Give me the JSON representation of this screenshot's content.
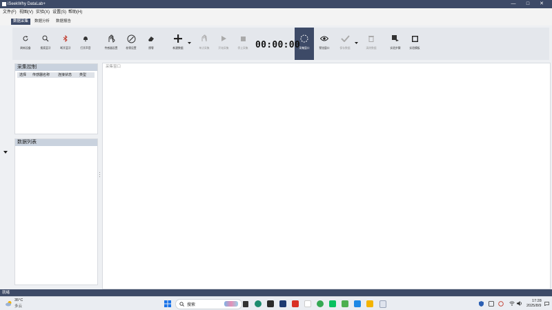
{
  "app": {
    "title": "iSeekWhy DataLab+"
  },
  "window_controls": {
    "minimize": "—",
    "maximize": "□",
    "close": "✕"
  },
  "menu": [
    {
      "label": "文件(F)"
    },
    {
      "label": "视图(V)"
    },
    {
      "label": "实验(X)"
    },
    {
      "label": "设置(S)"
    },
    {
      "label": "帮助(H)"
    }
  ],
  "tabs": [
    {
      "label": "数据采集",
      "active": true
    },
    {
      "label": "数据分析",
      "active": false
    },
    {
      "label": "数据报告",
      "active": false
    }
  ],
  "toolbar": {
    "refresh": "刷新设备",
    "search_bt": "搜索蓝牙",
    "disconnect_bt": "断开蓝牙",
    "sound_on": "打开声音",
    "sensor_settings": "传感器设置",
    "calibrate": "校零设置",
    "eraser": "擦零",
    "new_data": "新建数据",
    "single_collect": "单点采集",
    "start_collect": "开始采集",
    "stop_collect": "停止采集",
    "timer": "00:00:00",
    "collect_window": "采集窗口",
    "preview_window": "预览窗口",
    "save_data": "保存数据",
    "clear_data": "清除数据",
    "experiment_steps": "实验步骤",
    "experiment_template": "实验模板"
  },
  "left_panel": {
    "control_title": "采集控制",
    "columns": [
      "选择",
      "传感器名称",
      "连接状态",
      "类型"
    ],
    "data_list_title": "数据列表"
  },
  "main_area": {
    "label": "采集窗口"
  },
  "status_bar": {
    "text": "就绪"
  },
  "taskbar": {
    "weather_temp": "35°C",
    "weather_desc": "多云",
    "search_placeholder": "搜索",
    "time": "17:28",
    "date": "2025/8/9"
  }
}
